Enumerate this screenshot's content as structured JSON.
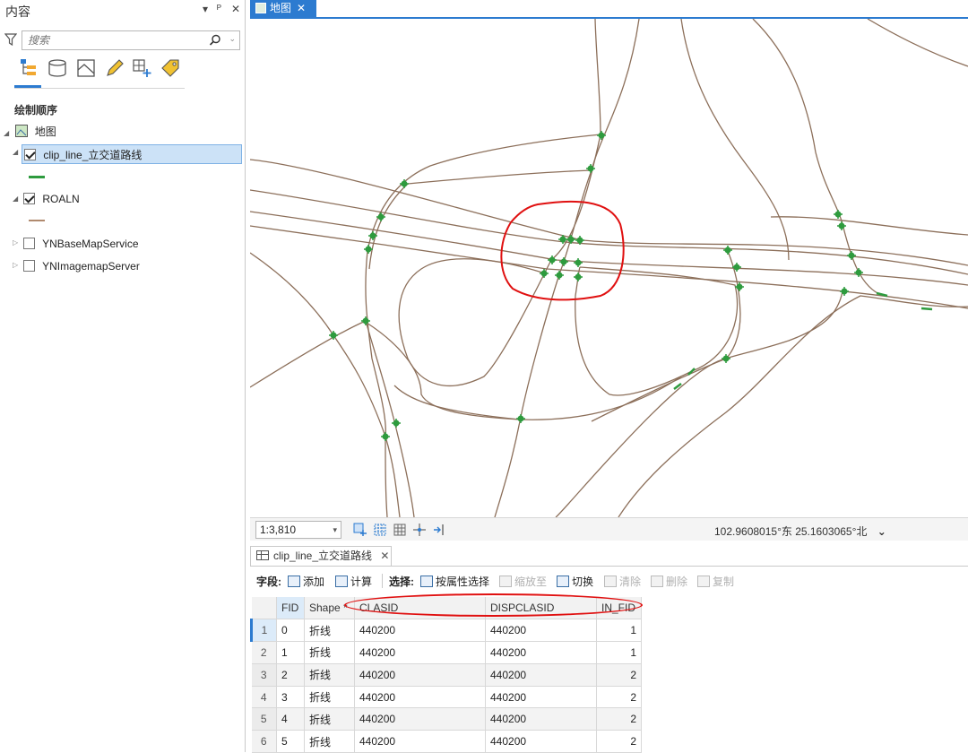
{
  "contents_pane": {
    "title": "内容",
    "controls": [
      "▾",
      "ᵖ",
      "✕"
    ],
    "search_placeholder": "搜索",
    "section_title": "绘制顺序",
    "map_label": "地图",
    "layers": [
      {
        "name": "clip_line_立交道路线",
        "checked": true,
        "selected": true,
        "expanded": true,
        "symbol_color": "#2e9b3e"
      },
      {
        "name": "ROALN",
        "checked": true,
        "selected": false,
        "expanded": true,
        "symbol_color": "#b08a6e"
      },
      {
        "name": "YNBaseMapService",
        "checked": false,
        "selected": false,
        "expanded": false
      },
      {
        "name": "YNImagemapServer",
        "checked": false,
        "selected": false,
        "expanded": false
      }
    ]
  },
  "map_tab": {
    "label": "地图",
    "close": "✕"
  },
  "status_bar": {
    "scale": "1:3,810",
    "coordinates": "102.9608015°东 25.1603065°北",
    "coords_dropdown": "⌄"
  },
  "table_tab": {
    "label": "clip_line_立交道路线",
    "close": "✕"
  },
  "table_toolbar": {
    "fields_label": "字段:",
    "add": "添加",
    "calculate": "计算",
    "selection_label": "选择:",
    "select_by_attr": "按属性选择",
    "zoom_to": "缩放至",
    "switch": "切换",
    "clear": "清除",
    "delete": "删除",
    "copy": "复制"
  },
  "attribute_table": {
    "columns": [
      "FID",
      "Shape *",
      "CLASID",
      "DISPCLASID",
      "IN_FID"
    ],
    "rows": [
      {
        "n": "1",
        "fid": "0",
        "shape": "折线",
        "clasid": "440200",
        "disp": "440200",
        "in_fid": "1"
      },
      {
        "n": "2",
        "fid": "1",
        "shape": "折线",
        "clasid": "440200",
        "disp": "440200",
        "in_fid": "1"
      },
      {
        "n": "3",
        "fid": "2",
        "shape": "折线",
        "clasid": "440200",
        "disp": "440200",
        "in_fid": "2"
      },
      {
        "n": "4",
        "fid": "3",
        "shape": "折线",
        "clasid": "440200",
        "disp": "440200",
        "in_fid": "2"
      },
      {
        "n": "5",
        "fid": "4",
        "shape": "折线",
        "clasid": "440200",
        "disp": "440200",
        "in_fid": "2"
      },
      {
        "n": "6",
        "fid": "5",
        "shape": "折线",
        "clasid": "440200",
        "disp": "440200",
        "in_fid": "2"
      }
    ]
  },
  "colors": {
    "accent": "#2c7bd0",
    "road": "#8c6f5a",
    "clip_line": "#2e9b3e",
    "annotation": "#e01010"
  }
}
